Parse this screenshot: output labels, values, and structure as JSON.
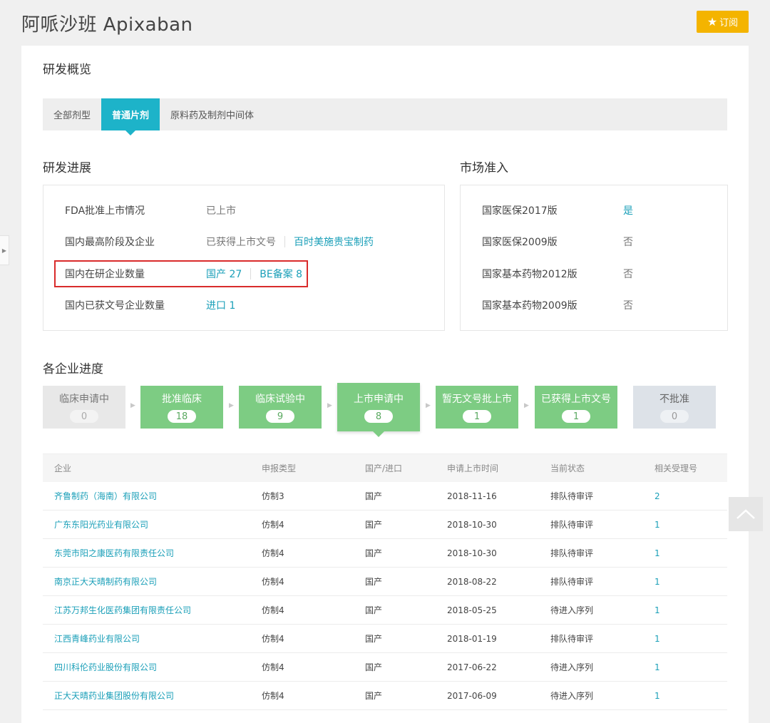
{
  "page": {
    "title": "阿哌沙班 Apixaban",
    "subscribe_label": "订阅"
  },
  "overview": {
    "title": "研发概览",
    "tabs": [
      {
        "label": "全部剂型",
        "active": false
      },
      {
        "label": "普通片剂",
        "active": true
      },
      {
        "label": "原料药及制剂中间体",
        "active": false
      }
    ]
  },
  "progress": {
    "title": "研发进展",
    "fda": {
      "label": "FDA批准上市情况",
      "value": "已上市"
    },
    "highest": {
      "label": "国内最高阶段及企业",
      "value": "已获得上市文号",
      "company": "百时美施贵宝制药"
    },
    "researching": {
      "label": "国内在研企业数量",
      "domestic": "国产 27",
      "be": "BE备案 8"
    },
    "approved": {
      "label": "国内已获文号企业数量",
      "import": "进口 1"
    }
  },
  "market": {
    "title": "市场准入",
    "items": [
      {
        "label": "国家医保2017版",
        "value": "是"
      },
      {
        "label": "国家医保2009版",
        "value": "否"
      },
      {
        "label": "国家基本药物2012版",
        "value": "否"
      },
      {
        "label": "国家基本药物2009版",
        "value": "否"
      }
    ]
  },
  "companies": {
    "title": "各企业进度",
    "stages": [
      {
        "label": "临床申请中",
        "count": "0"
      },
      {
        "label": "批准临床",
        "count": "18"
      },
      {
        "label": "临床试验中",
        "count": "9"
      },
      {
        "label": "上市申请中",
        "count": "8"
      },
      {
        "label": "暂无文号批上市",
        "count": "1"
      },
      {
        "label": "已获得上市文号",
        "count": "1"
      },
      {
        "label": "不批准",
        "count": "0"
      }
    ],
    "table": {
      "headers": [
        "企业",
        "申报类型",
        "国产/进口",
        "申请上市时间",
        "当前状态",
        "相关受理号"
      ],
      "rows": [
        [
          "齐鲁制药（海南）有限公司",
          "仿制3",
          "国产",
          "2018-11-16",
          "排队待审评",
          "2"
        ],
        [
          "广东东阳光药业有限公司",
          "仿制4",
          "国产",
          "2018-10-30",
          "排队待审评",
          "1"
        ],
        [
          "东莞市阳之康医药有限责任公司",
          "仿制4",
          "国产",
          "2018-10-30",
          "排队待审评",
          "1"
        ],
        [
          "南京正大天晴制药有限公司",
          "仿制4",
          "国产",
          "2018-08-22",
          "排队待审评",
          "1"
        ],
        [
          "江苏万邦生化医药集团有限责任公司",
          "仿制4",
          "国产",
          "2018-05-25",
          "待进入序列",
          "1"
        ],
        [
          "江西青峰药业有限公司",
          "仿制4",
          "国产",
          "2018-01-19",
          "排队待审评",
          "1"
        ],
        [
          "四川科伦药业股份有限公司",
          "仿制4",
          "国产",
          "2017-06-22",
          "待进入序列",
          "1"
        ],
        [
          "正大天晴药业集团股份有限公司",
          "仿制4",
          "国产",
          "2017-06-09",
          "待进入序列",
          "1"
        ]
      ]
    }
  },
  "icons": {
    "subscribe": "star-icon",
    "back_to_top": "chevron-up-icon",
    "side_handle": "caret-right-icon"
  }
}
